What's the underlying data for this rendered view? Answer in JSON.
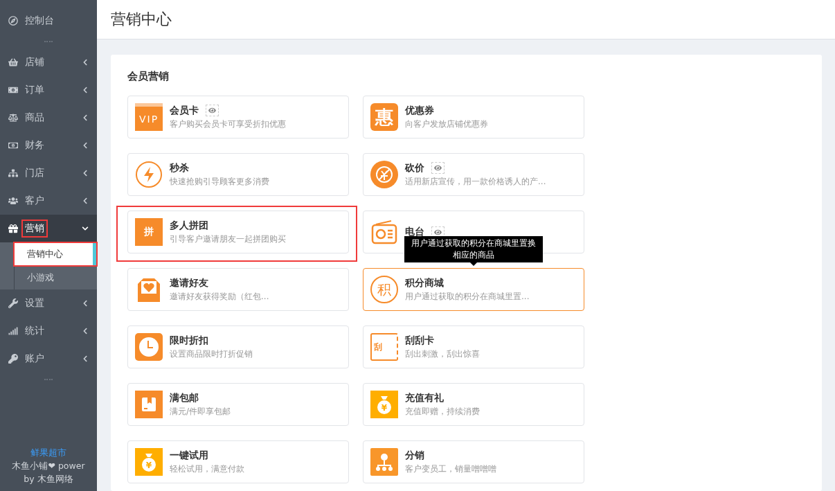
{
  "sidebar": {
    "items": [
      {
        "label": "控制台",
        "expandable": false,
        "expanded": false,
        "annotated": false
      },
      {
        "kind": "separator"
      },
      {
        "label": "店铺",
        "expandable": true,
        "expanded": false,
        "annotated": false
      },
      {
        "label": "订单",
        "expandable": true,
        "expanded": false,
        "annotated": false
      },
      {
        "label": "商品",
        "expandable": true,
        "expanded": false,
        "annotated": false
      },
      {
        "label": "财务",
        "expandable": true,
        "expanded": false,
        "annotated": false
      },
      {
        "label": "门店",
        "expandable": true,
        "expanded": false,
        "annotated": false
      },
      {
        "label": "客户",
        "expandable": true,
        "expanded": false,
        "annotated": false
      },
      {
        "label": "营销",
        "expandable": true,
        "expanded": true,
        "annotated": true,
        "children": [
          {
            "label": "营销中心",
            "selected": true,
            "annotated": true
          },
          {
            "label": "小游戏",
            "selected": false,
            "annotated": false
          }
        ]
      },
      {
        "label": "设置",
        "expandable": true,
        "expanded": false,
        "annotated": false
      },
      {
        "label": "统计",
        "expandable": true,
        "expanded": false,
        "annotated": false
      },
      {
        "label": "账户",
        "expandable": true,
        "expanded": false,
        "annotated": false
      },
      {
        "kind": "separator"
      }
    ],
    "footer": {
      "shop": "鲜果超市",
      "brand": "木鱼小铺❤ power",
      "by": "by 木鱼网络"
    }
  },
  "page": {
    "title": "营销中心"
  },
  "section": {
    "title": "会员营销",
    "cards": [
      {
        "name": "会员卡",
        "desc": "客户购买会员卡可享受折扣优惠",
        "kind": "vip",
        "glyph": "VIP",
        "preview": true,
        "hovered": false,
        "annotated": false
      },
      {
        "name": "优惠券",
        "desc": "向客户发放店铺优惠券",
        "kind": "tile",
        "glyph": "惠",
        "preview": false,
        "hovered": false,
        "annotated": false
      },
      {
        "name": "秒杀",
        "desc": "快速抢购引导顾客更多消费",
        "kind": "bolt",
        "preview": false,
        "hovered": false,
        "annotated": false
      },
      {
        "name": "砍价",
        "desc": "适用新店宣传，用一款价格诱人的产...",
        "kind": "disc",
        "preview": true,
        "hovered": false,
        "annotated": false
      },
      {
        "name": "多人拼团",
        "desc": "引导客户邀请朋友一起拼团购买",
        "kind": "square",
        "glyph": "拼",
        "preview": false,
        "hovered": false,
        "annotated": true
      },
      {
        "name": "电台",
        "kind": "radio",
        "preview": true,
        "hovered": false,
        "annotated": false
      },
      {
        "name": "邀请好友",
        "desc": "邀请好友获得奖励（红包...",
        "kind": "envelope",
        "preview": false,
        "hovered": false,
        "annotated": false
      },
      {
        "name": "积分商城",
        "desc": "用户通过获取的积分在商城里置...",
        "kind": "ring",
        "glyph": "积",
        "preview": false,
        "hovered": true,
        "annotated": false,
        "tooltip": "用户通过获取的积分在商城里置换相应的商品"
      },
      {
        "name": "限时折扣",
        "desc": "设置商品限时打折促销",
        "kind": "clock",
        "preview": false,
        "hovered": false,
        "annotated": false
      },
      {
        "name": "刮刮卡",
        "desc": "刮出刺激，刮出惊喜",
        "kind": "scratch",
        "glyph": "刮",
        "preview": false,
        "hovered": false,
        "annotated": false
      },
      {
        "name": "满包邮",
        "desc": "满元/件即享包邮",
        "kind": "box",
        "preview": false,
        "hovered": false,
        "annotated": false
      },
      {
        "name": "充值有礼",
        "desc": "充值即赠，持续消费",
        "kind": "bag",
        "glyph": "¥",
        "preview": false,
        "hovered": false,
        "annotated": false
      },
      {
        "name": "一键试用",
        "desc": "轻松试用，满意付款",
        "kind": "bag",
        "glyph": "¥",
        "preview": false,
        "hovered": false,
        "annotated": false
      },
      {
        "name": "分销",
        "desc": "客户变员工，销量噌噌噌",
        "kind": "tree",
        "preview": false,
        "hovered": false,
        "annotated": false
      }
    ]
  }
}
